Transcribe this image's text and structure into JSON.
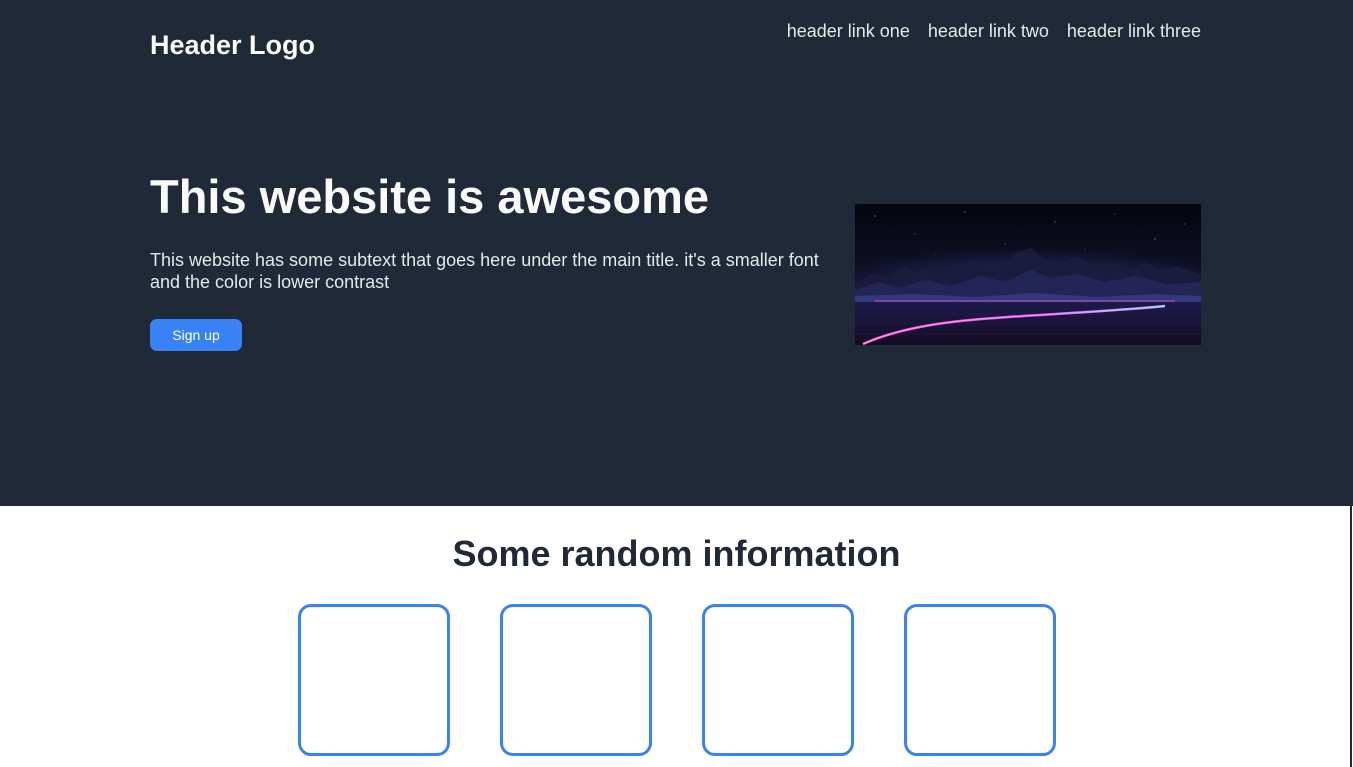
{
  "header": {
    "logo": "Header Logo",
    "links": [
      {
        "label": "header link one"
      },
      {
        "label": "header link two"
      },
      {
        "label": "header link three"
      }
    ]
  },
  "hero": {
    "title": "This website is awesome",
    "subtext": "This website has some subtext that goes here under the main title. it's a smaller font and the color is lower contrast",
    "signup_label": "Sign up",
    "image": "neon-mountain-lake-landscape"
  },
  "info": {
    "title": "Some random information",
    "cards": [
      {},
      {},
      {},
      {}
    ]
  },
  "colors": {
    "dark_background": "#1f2937",
    "accent_blue": "#3882f6",
    "light_text": "#f9faf8",
    "muted_text": "#e5e7eb"
  }
}
